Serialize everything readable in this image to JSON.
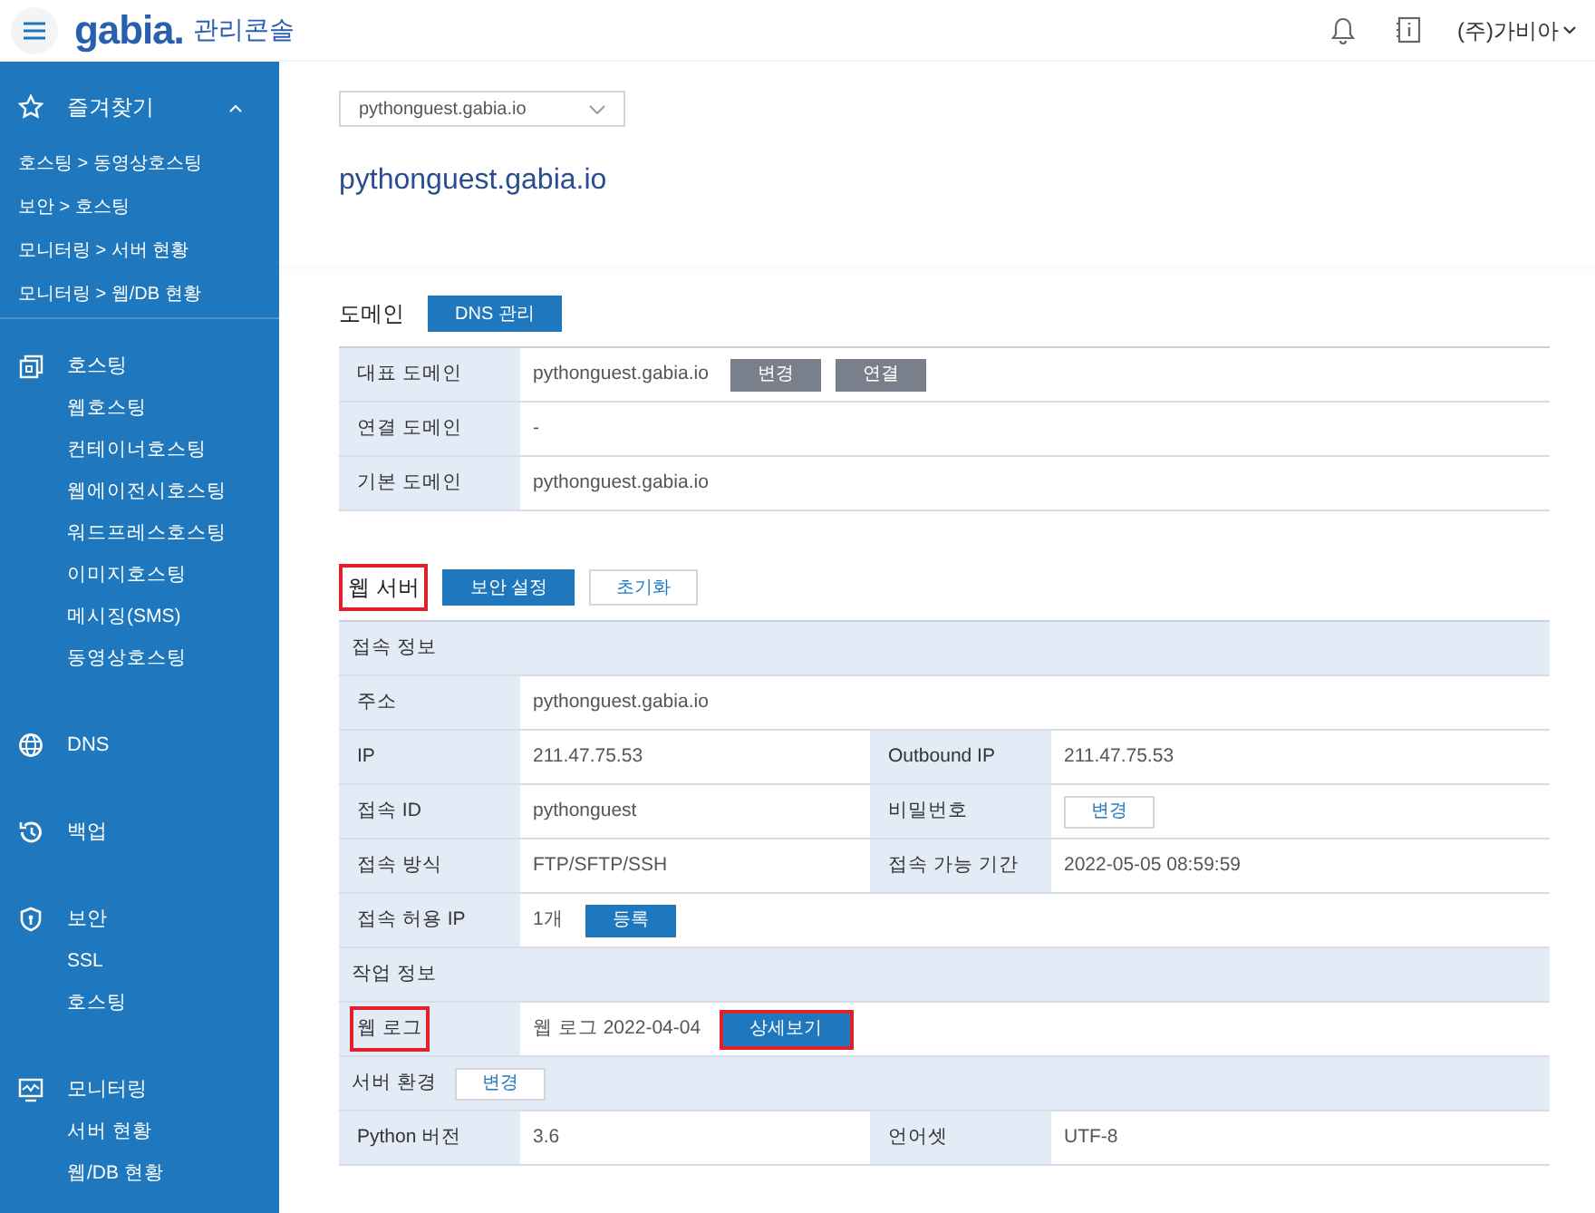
{
  "header": {
    "logo": "gabia.",
    "title": "관리콘솔",
    "user": "(주)가비아"
  },
  "sidebar": {
    "favorites": {
      "label": "즐겨찾기",
      "expanded": true,
      "links": [
        "호스팅 > 동영상호스팅",
        "보안 > 호스팅",
        "모니터링 > 서버 현황",
        "모니터링 > 웹/DB 현황"
      ]
    },
    "groups": [
      {
        "kind": "hosting",
        "label": "호스팅",
        "children": [
          "웹호스팅",
          "컨테이너호스팅",
          "웹에이전시호스팅",
          "워드프레스호스팅",
          "이미지호스팅",
          "메시징(SMS)",
          "동영상호스팅"
        ]
      },
      {
        "kind": "dns",
        "label": "DNS"
      },
      {
        "kind": "backup",
        "label": "백업"
      },
      {
        "kind": "security",
        "label": "보안",
        "children": [
          "SSL",
          "호스팅"
        ]
      },
      {
        "kind": "monitoring",
        "label": "모니터링",
        "children": [
          "서버 현황",
          "웹/DB 현황"
        ]
      }
    ]
  },
  "domain_select": {
    "value": "pythonguest.gabia.io"
  },
  "heading": "pythonguest.gabia.io",
  "sections": [
    {
      "title": "도메인",
      "highlighted": false,
      "buttons": [
        {
          "label": "DNS 관리",
          "kind": "primary",
          "highlighted": false
        }
      ],
      "rows": [
        {
          "kind": "row",
          "cells": [
            {
              "kind": "label",
              "text": "대표 도메인",
              "highlighted": false
            },
            {
              "kind": "value",
              "text": "pythonguest.gabia.io",
              "buttons": [
                {
                  "label": "변경",
                  "kind": "gray",
                  "highlighted": false
                },
                {
                  "label": "연결",
                  "kind": "gray",
                  "highlighted": false
                }
              ]
            }
          ]
        },
        {
          "kind": "row",
          "cells": [
            {
              "kind": "label",
              "text": "연결 도메인",
              "highlighted": false
            },
            {
              "kind": "value",
              "text": "-"
            }
          ]
        },
        {
          "kind": "row",
          "cells": [
            {
              "kind": "label",
              "text": "기본 도메인",
              "highlighted": false
            },
            {
              "kind": "value",
              "text": "pythonguest.gabia.io"
            }
          ]
        }
      ]
    },
    {
      "title": "웹 서버",
      "highlighted": true,
      "buttons": [
        {
          "label": "보안 설정",
          "kind": "primary",
          "highlighted": false
        },
        {
          "label": "초기화",
          "kind": "outline",
          "highlighted": false
        }
      ],
      "rows": [
        {
          "kind": "section",
          "text": "접속 정보"
        },
        {
          "kind": "row",
          "cells": [
            {
              "kind": "label",
              "text": "주소",
              "highlighted": false
            },
            {
              "kind": "value",
              "text": "pythonguest.gabia.io"
            }
          ]
        },
        {
          "kind": "row",
          "cells": [
            {
              "kind": "label",
              "text": "IP",
              "highlighted": false
            },
            {
              "kind": "value",
              "text": "211.47.75.53"
            },
            {
              "kind": "label",
              "text": "Outbound IP",
              "highlighted": false
            },
            {
              "kind": "value",
              "text": "211.47.75.53"
            }
          ]
        },
        {
          "kind": "row",
          "cells": [
            {
              "kind": "label",
              "text": "접속 ID",
              "highlighted": false
            },
            {
              "kind": "value",
              "text": "pythonguest"
            },
            {
              "kind": "label",
              "text": "비밀번호",
              "highlighted": false
            },
            {
              "kind": "value",
              "buttons": [
                {
                  "label": "변경",
                  "kind": "outline",
                  "highlighted": false
                }
              ]
            }
          ]
        },
        {
          "kind": "row",
          "cells": [
            {
              "kind": "label",
              "text": "접속 방식",
              "highlighted": false
            },
            {
              "kind": "value",
              "text": "FTP/SFTP/SSH"
            },
            {
              "kind": "label",
              "text": "접속 가능 기간",
              "highlighted": false
            },
            {
              "kind": "value",
              "text": "2022-05-05 08:59:59"
            }
          ]
        },
        {
          "kind": "row",
          "cells": [
            {
              "kind": "label",
              "text": "접속 허용 IP",
              "highlighted": false
            },
            {
              "kind": "value",
              "text": "1개",
              "buttons": [
                {
                  "label": "등록",
                  "kind": "primary",
                  "highlighted": false
                }
              ]
            }
          ]
        },
        {
          "kind": "section",
          "text": "작업 정보"
        },
        {
          "kind": "row",
          "cells": [
            {
              "kind": "label",
              "text": "웹 로그",
              "highlighted": true
            },
            {
              "kind": "value",
              "text": "웹 로그 2022-04-04",
              "buttons": [
                {
                  "label": "상세보기",
                  "kind": "primary",
                  "highlighted": true
                }
              ]
            }
          ]
        },
        {
          "kind": "section",
          "text": "서버 환경",
          "buttons": [
            {
              "label": "변경",
              "kind": "outline",
              "highlighted": false
            }
          ]
        },
        {
          "kind": "row",
          "cells": [
            {
              "kind": "label",
              "text": "Python 버전",
              "highlighted": false
            },
            {
              "kind": "value",
              "text": "3.6"
            },
            {
              "kind": "label",
              "text": "언어셋",
              "highlighted": false
            },
            {
              "kind": "value",
              "text": "UTF-8"
            }
          ]
        }
      ]
    }
  ]
}
